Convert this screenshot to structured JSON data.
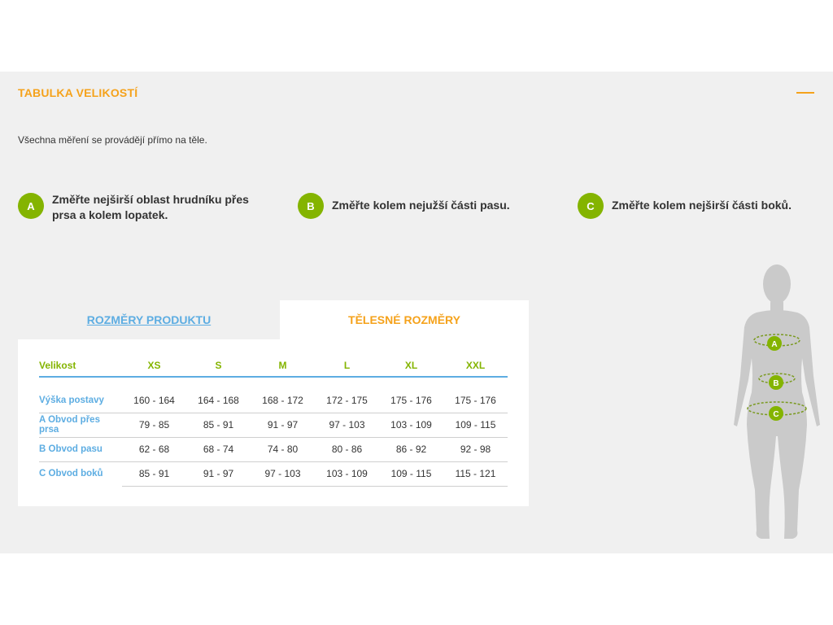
{
  "header": {
    "title": "TABULKA VELIKOSTÍ"
  },
  "intro": "Všechna měření se provádějí přímo na těle.",
  "steps": [
    {
      "badge": "A",
      "text": "Změřte nejširší oblast hrudníku přes prsa a kolem lopatek."
    },
    {
      "badge": "B",
      "text": "Změřte kolem nejužší části pasu."
    },
    {
      "badge": "C",
      "text": "Změřte kolem nejširší části boků."
    }
  ],
  "tabs": {
    "product": "ROZMĚRY PRODUKTU",
    "body": "TĚLESNÉ ROZMĚRY",
    "active": "body"
  },
  "table": {
    "headers": [
      "Velikost",
      "XS",
      "S",
      "M",
      "L",
      "XL",
      "XXL"
    ],
    "rows": [
      {
        "label": "Výška postavy",
        "values": [
          "160 - 164",
          "164 - 168",
          "168 - 172",
          "172 - 175",
          "175 - 176",
          "175 - 176"
        ]
      },
      {
        "label": "A Obvod přes prsa",
        "values": [
          "79 - 85",
          "85 - 91",
          "91 - 97",
          "97 - 103",
          "103 - 109",
          "109 - 115"
        ]
      },
      {
        "label": "B Obvod pasu",
        "values": [
          "62 - 68",
          "68 - 74",
          "74 - 80",
          "80 - 86",
          "86 - 92",
          "92 - 98"
        ]
      },
      {
        "label": "C Obvod boků",
        "values": [
          "85 - 91",
          "91 - 97",
          "97 - 103",
          "103 - 109",
          "109 - 115",
          "115 - 121"
        ]
      }
    ]
  },
  "figure": {
    "markers": [
      "A",
      "B",
      "C"
    ]
  },
  "colors": {
    "accent": "#f5a21b",
    "green": "#84b400",
    "blue": "#5dade2",
    "panel": "#f0f0f0"
  }
}
